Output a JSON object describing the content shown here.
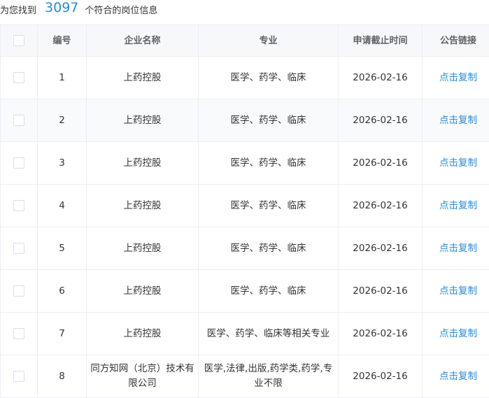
{
  "summary": {
    "prefix": "为您找到",
    "count": "3097",
    "suffix": "个符合的岗位信息"
  },
  "table": {
    "headers": {
      "num": "编号",
      "company": "企业名称",
      "major": "专业",
      "deadline": "申请截止时间",
      "link": "公告链接"
    },
    "rows": [
      {
        "num": "1",
        "company": "上药控股",
        "major": "医学、药学、临床",
        "deadline": "2026-02-16",
        "link": "点击复制"
      },
      {
        "num": "2",
        "company": "上药控股",
        "major": "医学、药学、临床",
        "deadline": "2026-02-16",
        "link": "点击复制"
      },
      {
        "num": "3",
        "company": "上药控股",
        "major": "医学、药学、临床",
        "deadline": "2026-02-16",
        "link": "点击复制"
      },
      {
        "num": "4",
        "company": "上药控股",
        "major": "医学、药学、临床",
        "deadline": "2026-02-16",
        "link": "点击复制"
      },
      {
        "num": "5",
        "company": "上药控股",
        "major": "医学、药学、临床",
        "deadline": "2026-02-16",
        "link": "点击复制"
      },
      {
        "num": "6",
        "company": "上药控股",
        "major": "医学、药学、临床",
        "deadline": "2026-02-16",
        "link": "点击复制"
      },
      {
        "num": "7",
        "company": "上药控股",
        "major": "医学、药学、临床等相关专业",
        "deadline": "2026-02-16",
        "link": "点击复制"
      },
      {
        "num": "8",
        "company": "同方知网（北京）技术有限公司",
        "major": "医学,法律,出版,药学类,药学,专业不限",
        "deadline": "2026-02-16",
        "link": "点击复制"
      }
    ]
  }
}
